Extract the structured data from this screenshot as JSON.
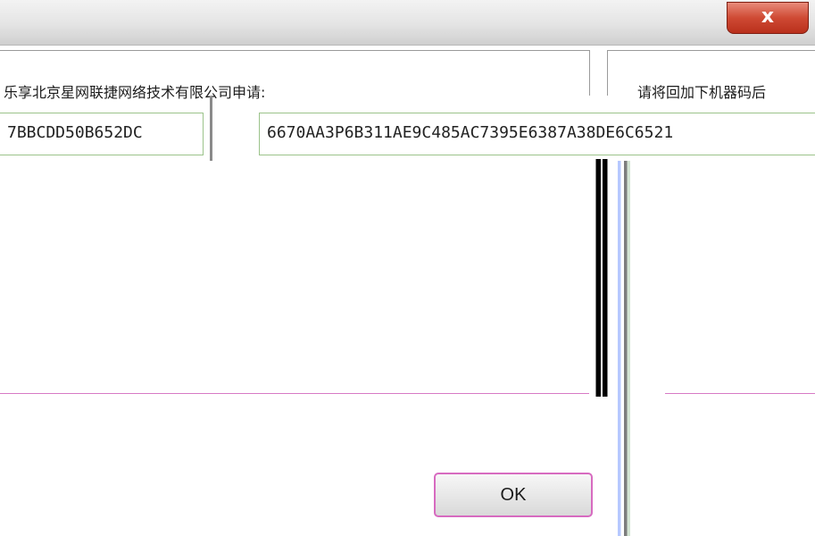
{
  "window": {
    "close_label": "x"
  },
  "panels": {
    "left": {
      "label": "乐享北京星网联捷网络技术有限公司申请:",
      "value": "7BBCDD50B652DC"
    },
    "right": {
      "label": "请将回加下机器码后",
      "value": "6670AA3P6B311AE9C485AC7395E6387A38DE6C6521"
    }
  },
  "footer": {
    "ok_label": "OK"
  }
}
